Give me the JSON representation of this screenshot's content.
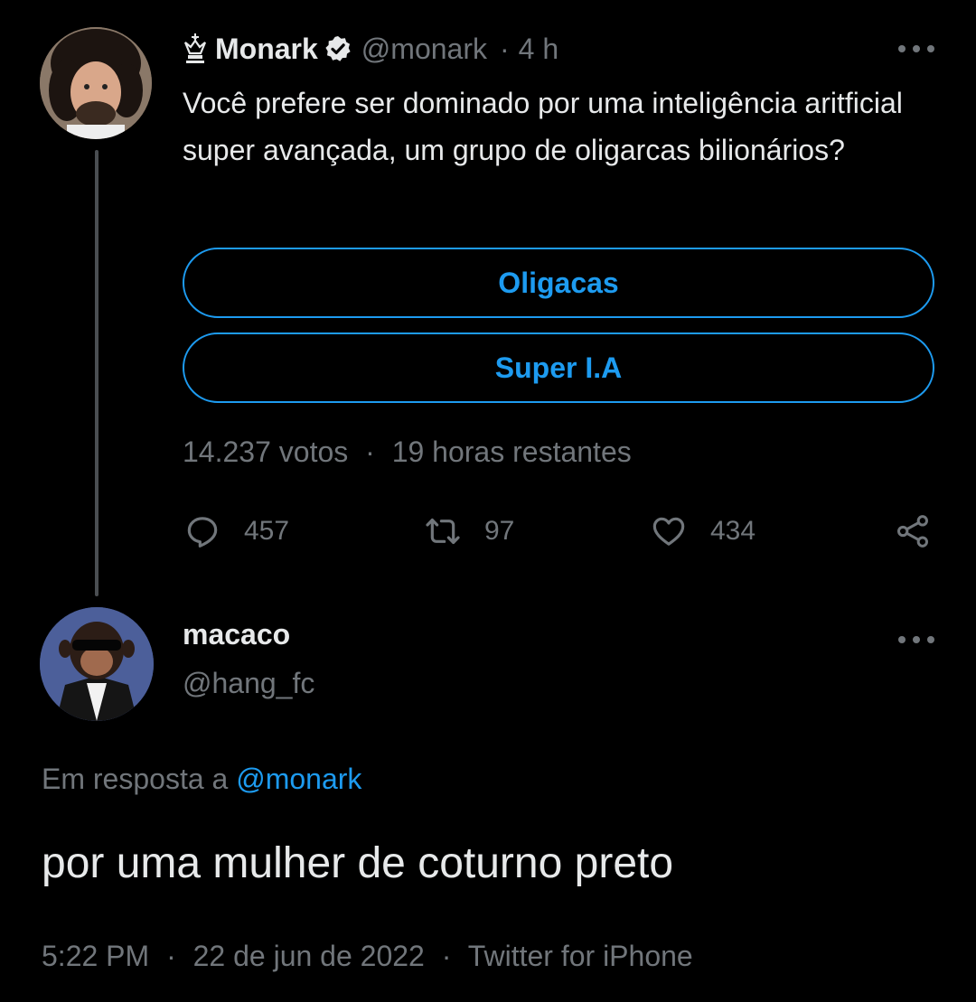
{
  "parent_tweet": {
    "display_name": "Monark",
    "handle": "@monark",
    "time_ago": "4 h",
    "text": "Você prefere ser dominado por uma inteligência aritficial super avançada, um grupo de oligarcas bilionários?",
    "poll": {
      "options": [
        "Oligacas",
        "Super I.A"
      ],
      "votes": "14.237 votos",
      "time_left": "19 horas restantes"
    },
    "stats": {
      "replies": "457",
      "retweets": "97",
      "likes": "434"
    },
    "icons": [
      "crown-icon",
      "verified-icon",
      "more-icon",
      "reply-icon",
      "retweet-icon",
      "like-icon",
      "share-icon"
    ]
  },
  "reply_tweet": {
    "display_name": "macaco",
    "handle": "@hang_fc",
    "in_reply_to_prefix": "Em resposta a",
    "in_reply_to_handle": "@monark",
    "text": "por uma mulher de coturno preto",
    "time": "5:22 PM",
    "date": "22 de jun de 2022",
    "source": "Twitter for iPhone"
  },
  "separator": "·",
  "colors": {
    "background": "#000000",
    "text": "#e7e9ea",
    "muted": "#71767b",
    "accent": "#1d9bf0",
    "thread_line": "#4a4e52"
  }
}
